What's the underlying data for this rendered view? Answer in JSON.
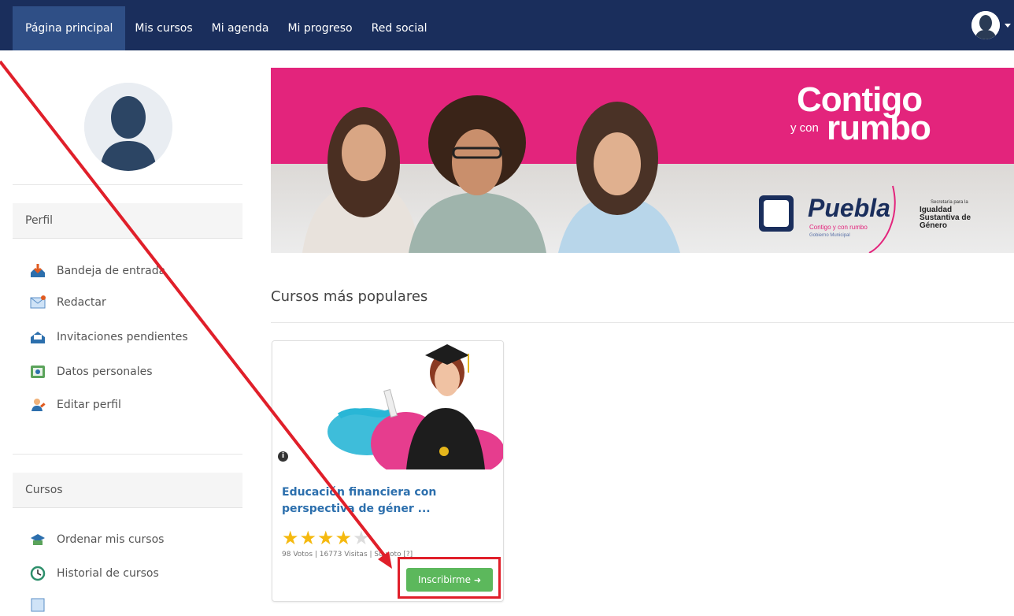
{
  "nav": {
    "items": [
      "Página principal",
      "Mis cursos",
      "Mi agenda",
      "Mi progreso",
      "Red social"
    ]
  },
  "sidebar": {
    "profile": {
      "title": "Perfil",
      "items": [
        {
          "label": "Bandeja de entrada",
          "icon": "inbox-icon"
        },
        {
          "label": "Redactar",
          "icon": "envelope-icon"
        },
        {
          "label": "Invitaciones pendientes",
          "icon": "invitations-icon"
        },
        {
          "label": "Datos personales",
          "icon": "personal-data-icon"
        },
        {
          "label": "Editar perfil",
          "icon": "edit-profile-icon"
        }
      ]
    },
    "courses": {
      "title": "Cursos",
      "items": [
        {
          "label": "Ordenar mis cursos",
          "icon": "sort-courses-icon"
        },
        {
          "label": "Historial de cursos",
          "icon": "history-icon"
        }
      ]
    }
  },
  "banner": {
    "title_line1": "Contigo",
    "title_small": "y con",
    "title_line2": "rumbo",
    "logo_name": "Puebla",
    "logo_tagline": "Contigo y con rumbo",
    "logo_sub": "Gobierno Municipal",
    "secretaria_small": "Secretaría para la",
    "secretaria_line1": "Igualdad",
    "secretaria_line2": "Sustantiva de",
    "secretaria_line3": "Género"
  },
  "popular": {
    "title": "Cursos más populares"
  },
  "course": {
    "title": "Educación financiera con perspectiva de géner ...",
    "rating": 4,
    "rating_max": 5,
    "meta": "98 Votos | 16773 Visitas | Su voto [?]",
    "enroll_label": "Inscribirme"
  },
  "colors": {
    "topbar": "#1a2e5c",
    "accent_pink": "#e3247c",
    "enroll_green": "#5cb85c",
    "annotation_red": "#e01f2a",
    "star_gold": "#f5b90f"
  }
}
